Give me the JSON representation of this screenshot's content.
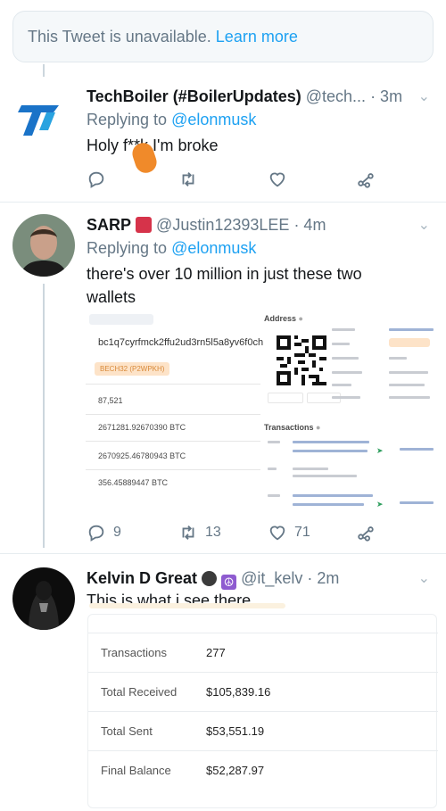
{
  "unavailable": {
    "text": "This Tweet is unavailable.",
    "link": "Learn more"
  },
  "tweets": [
    {
      "name": "TechBoiler (#BoilerUpdates)",
      "handle": "@tech...",
      "time": "· 3m",
      "reply_prefix": "Replying to",
      "reply_to": "@elonmusk",
      "text": "Holy f**k I'm broke",
      "counts": {
        "reply": "",
        "retweet": "",
        "like": ""
      }
    },
    {
      "name": "SARP",
      "handle": "@Justin12393LEE",
      "time": "· 4m",
      "reply_prefix": "Replying to",
      "reply_to": "@elonmusk",
      "text": "there's over 10 million in just these two wallets",
      "counts": {
        "reply": "9",
        "retweet": "13",
        "like": "71"
      }
    },
    {
      "name": "Kelvin D Great",
      "handle": "@it_kelv",
      "time": "· 2m",
      "text": "This is what i see there"
    }
  ],
  "wallet": {
    "address": "bc1q7cyrfmck2ffu2ud3rn5l5a8yv6f0ch",
    "tag": "BECH32 (P2WPKH)",
    "rows": [
      "87,521",
      "2671281.92670390 BTC",
      "2670925.46780943 BTC",
      "356.45889447 BTC"
    ],
    "address_label": "Address",
    "transactions_label": "Transactions"
  },
  "balance_table": {
    "rows": [
      {
        "label": "Transactions",
        "value": "277"
      },
      {
        "label": "Total Received",
        "value": "$105,839.16"
      },
      {
        "label": "Total Sent",
        "value": "$53,551.19"
      },
      {
        "label": "Final Balance",
        "value": "$52,287.97"
      }
    ]
  },
  "colors": {
    "link": "#1da1f2",
    "muted": "#657786",
    "border": "#e6ecf0"
  },
  "icons": [
    "reply-icon",
    "retweet-icon",
    "like-icon",
    "share-icon",
    "chevron-down-icon"
  ]
}
